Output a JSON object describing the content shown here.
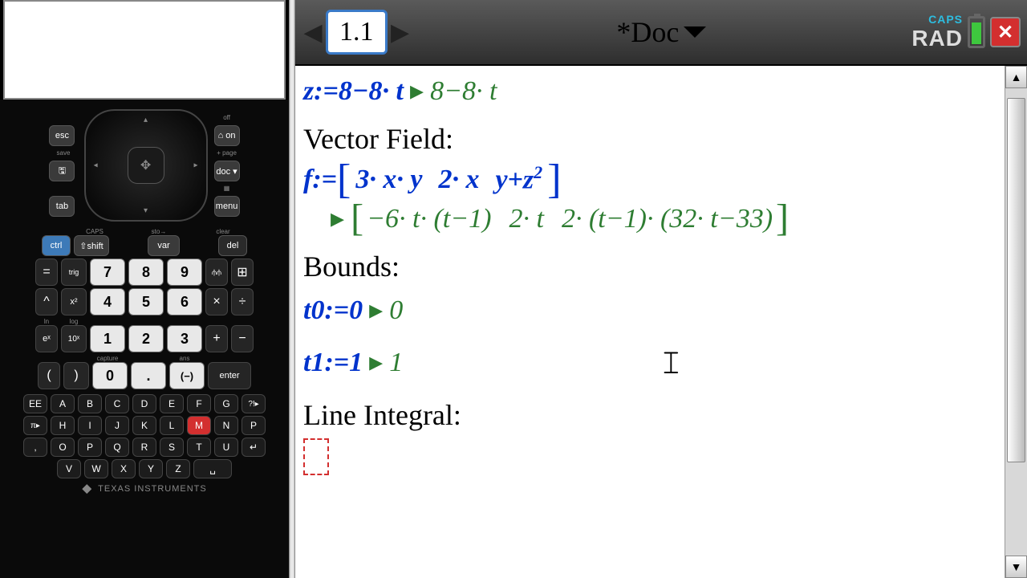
{
  "calc": {
    "esc": "esc",
    "save": "save",
    "save_icon_name": "save-icon",
    "undo_icon_name": "undo-icon",
    "zoom_icon_name": "zoom-icon",
    "off": "off",
    "home_on": "⌂ on",
    "page": "+ page",
    "doc": "doc ▾",
    "menu_icon_name": "menu-icon",
    "menu": "menu",
    "tab": "tab",
    "scratch_icon_name": "scratchpad-icon",
    "caps": "CAPS",
    "sto": "sto→",
    "clear": "clear",
    "ctrl": "ctrl",
    "shift": "⇧shift",
    "var": "var",
    "del": "del",
    "eq": "=",
    "trig": "trig",
    "k7": "7",
    "k8": "8",
    "k9": "9",
    "graph": "⫛⫛",
    "table": "⊞",
    "pow": "^",
    "sq": "x²",
    "k4": "4",
    "k5": "5",
    "k6": "6",
    "mul": "×",
    "div": "÷",
    "ex": "eˣ",
    "tenx": "10ˣ",
    "k1": "1",
    "k2": "2",
    "k3": "3",
    "plus": "+",
    "minus": "−",
    "lp": "(",
    "rp": ")",
    "k0": "0",
    "dot": ".",
    "neg": "(−)",
    "enter": "enter",
    "ln": "ln",
    "log": "log",
    "capture": "capture",
    "ans": "ans",
    "EE": "EE",
    "A": "A",
    "B": "B",
    "C": "C",
    "D": "D",
    "E": "E",
    "F": "F",
    "G": "G",
    "flag": "?!▸",
    "pi": "π▸",
    "H": "H",
    "I": "I",
    "J": "J",
    "K": "K",
    "L": "L",
    "M": "M",
    "N": "N",
    "P": "P",
    "comma": ",",
    "O": "O",
    "Pb": "P",
    "Q": "Q",
    "R": "R",
    "S": "S",
    "T": "T",
    "U": "U",
    "ret": "↵",
    "V": "V",
    "W": "W",
    "X": "X",
    "Y": "Y",
    "Z": "Z",
    "space": "␣",
    "brand": "TEXAS INSTRUMENTS"
  },
  "header": {
    "tab_label": "1.1",
    "doc_title": "*Doc",
    "caps": "CAPS",
    "mode": "RAD",
    "close": "✕"
  },
  "content": {
    "z_def": "z:=8−8· t",
    "z_res": "8−8· t",
    "vf_label": "Vector Field:",
    "f_label": "f:=",
    "f_v1": "3· x· y",
    "f_v2": "2· x",
    "f_v3": "y+z",
    "f_v3_exp": "2",
    "f_res1": "−6· t· (t−1)",
    "f_res2": "2· t",
    "f_res3": "2· (t−1)· (32· t−33)",
    "bounds_label": "Bounds:",
    "t0_def": "t0:=0",
    "t0_res": "0",
    "t1_def": "t1:=1",
    "t1_res": "1",
    "li_label": "Line Integral:"
  }
}
